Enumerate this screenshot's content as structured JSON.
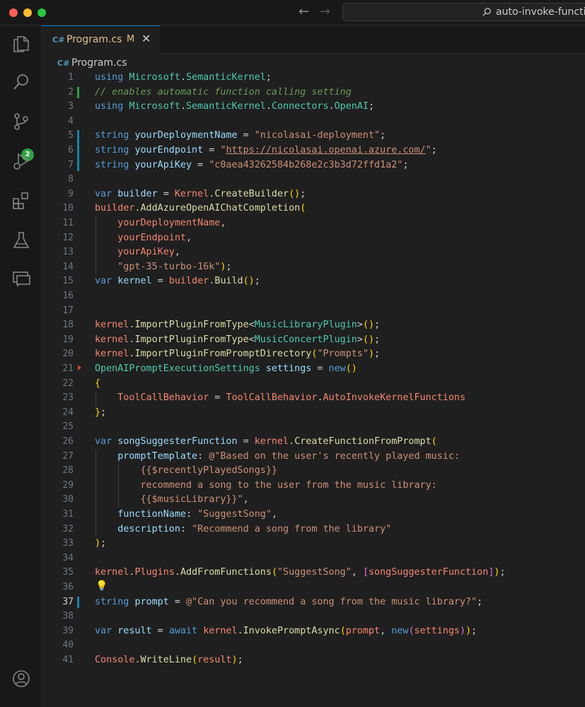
{
  "window": {
    "search_text": "auto-invoke-functio"
  },
  "tab": {
    "name": "Program.cs",
    "status": "M",
    "close": "✕"
  },
  "breadcrumb": {
    "file": "Program.cs"
  },
  "lightbulb": "💡",
  "editor": {
    "active_line": 37,
    "lines": [
      {
        "n": "1",
        "html": "<span class=\"k\">using</span> <span class=\"ns\">Microsoft</span>.<span class=\"ns\">SemanticKernel</span>;"
      },
      {
        "n": "2",
        "html": "<span class=\"cm\">// enables automatic function calling setting</span>"
      },
      {
        "n": "3",
        "html": "<span class=\"k\">using</span> <span class=\"ns\">Microsoft</span>.<span class=\"ns\">SemanticKernel</span>.<span class=\"ns\">Connectors</span>.<span class=\"ns\">OpenAI</span>;"
      },
      {
        "n": "4",
        "html": ""
      },
      {
        "n": "5",
        "html": "<span class=\"k\">string</span> <span class=\"v\">yourDeploymentName</span> = <span class=\"s\">\"nicolasai-deployment\"</span>;"
      },
      {
        "n": "6",
        "html": "<span class=\"k\">string</span> <span class=\"v\">yourEndpoint</span> = <span class=\"s\">\"<span class=\"u\">https://nicolasai.openai.azure.com/</span>\"</span>;"
      },
      {
        "n": "7",
        "html": "<span class=\"k\">string</span> <span class=\"v\">yourApiKey</span> = <span class=\"s\">\"c0aea43262584b268e2c3b3d72ffd1a2\"</span>;"
      },
      {
        "n": "8",
        "html": ""
      },
      {
        "n": "9",
        "html": "<span class=\"k\">var</span> <span class=\"v\">builder</span> = <span class=\"prop\">Kernel</span>.<span class=\"f\">CreateBuilder</span><span class=\"b1\">()</span>;"
      },
      {
        "n": "10",
        "html": "<span class=\"prop\">builder</span>.<span class=\"f\">AddAzureOpenAIChatCompletion</span><span class=\"b1\">(</span>"
      },
      {
        "n": "11",
        "html": "    <span class=\"prop\">yourDeploymentName</span>,"
      },
      {
        "n": "12",
        "html": "    <span class=\"prop\">yourEndpoint</span>,"
      },
      {
        "n": "13",
        "html": "    <span class=\"prop\">yourApiKey</span>,"
      },
      {
        "n": "14",
        "html": "    <span class=\"s\">\"gpt-35-turbo-16k\"</span><span class=\"b1\">)</span>;"
      },
      {
        "n": "15",
        "html": "<span class=\"k\">var</span> <span class=\"v\">kernel</span> = <span class=\"prop\">builder</span>.<span class=\"f\">Build</span><span class=\"b1\">()</span>;"
      },
      {
        "n": "16",
        "html": ""
      },
      {
        "n": "17",
        "html": ""
      },
      {
        "n": "18",
        "html": "<span class=\"prop\">kernel</span>.<span class=\"f\">ImportPluginFromType</span>&lt;<span class=\"cls\">MusicLibraryPlugin</span>&gt;<span class=\"b1\">()</span>;"
      },
      {
        "n": "19",
        "html": "<span class=\"prop\">kernel</span>.<span class=\"f\">ImportPluginFromType</span>&lt;<span class=\"cls\">MusicConcertPlugin</span>&gt;<span class=\"b1\">()</span>;"
      },
      {
        "n": "20",
        "html": "<span class=\"prop\">kernel</span>.<span class=\"f\">ImportPluginFromPromptDirectory</span><span class=\"b1\">(</span><span class=\"s\">\"Prompts\"</span><span class=\"b1\">)</span>;"
      },
      {
        "n": "21",
        "html": "<span class=\"cls\">OpenAIPromptExecutionSettings</span> <span class=\"v\">settings</span> = <span class=\"k\">new</span><span class=\"b1\">()</span>"
      },
      {
        "n": "22",
        "html": "<span class=\"b1\">{</span>"
      },
      {
        "n": "23",
        "html": "    <span class=\"prop\">ToolCallBehavior</span> = <span class=\"prop\">ToolCallBehavior</span>.<span class=\"prop\">AutoInvokeKernelFunctions</span>"
      },
      {
        "n": "24",
        "html": "<span class=\"b1\">}</span>;"
      },
      {
        "n": "25",
        "html": ""
      },
      {
        "n": "26",
        "html": "<span class=\"k\">var</span> <span class=\"v\">songSuggesterFunction</span> = <span class=\"prop\">kernel</span>.<span class=\"f\">CreateFunctionFromPrompt</span><span class=\"b1\">(</span>"
      },
      {
        "n": "27",
        "html": "    <span class=\"v\">promptTemplate</span>: <span class=\"s\">@\"Based on the user's recently played music:</span>"
      },
      {
        "n": "28",
        "html": "<span class=\"s\">        {{$recentlyPlayedSongs}}</span>"
      },
      {
        "n": "29",
        "html": "<span class=\"s\">        recommend a song to the user from the music library:</span>"
      },
      {
        "n": "30",
        "html": "<span class=\"s\">        {{$musicLibrary}}\"</span>,"
      },
      {
        "n": "31",
        "html": "    <span class=\"v\">functionName</span>: <span class=\"s\">\"SuggestSong\"</span>,"
      },
      {
        "n": "32",
        "html": "    <span class=\"v\">description</span>: <span class=\"s\">\"Recommend a song from the library\"</span>"
      },
      {
        "n": "33",
        "html": "<span class=\"b1\">)</span>;"
      },
      {
        "n": "34",
        "html": ""
      },
      {
        "n": "35",
        "html": "<span class=\"prop\">kernel</span>.<span class=\"prop\">Plugins</span>.<span class=\"f\">AddFromFunctions</span><span class=\"b1\">(</span><span class=\"s\">\"SuggestSong\"</span>, <span class=\"b2\">[</span><span class=\"prop\">songSuggesterFunction</span><span class=\"b2\">]</span><span class=\"b1\">)</span>;"
      },
      {
        "n": "36",
        "html": ""
      },
      {
        "n": "37",
        "html": "<span class=\"k\">string</span> <span class=\"v\">prompt</span> = <span class=\"s\">@\"Can you recommend a song from the music library?\"</span>;"
      },
      {
        "n": "38",
        "html": ""
      },
      {
        "n": "39",
        "html": "<span class=\"k\">var</span> <span class=\"v\">result</span> = <span class=\"k\">await</span> <span class=\"prop\">kernel</span>.<span class=\"f\">InvokePromptAsync</span><span class=\"b1\">(</span><span class=\"prop\">prompt</span>, <span class=\"k\">new</span><span class=\"b2\">(</span><span class=\"prop\">settings</span><span class=\"b2\">)</span><span class=\"b1\">)</span>;"
      },
      {
        "n": "40",
        "html": ""
      },
      {
        "n": "41",
        "html": "<span class=\"prop\">Console</span>.<span class=\"f\">WriteLine</span><span class=\"b1\">(</span><span class=\"prop\">result</span><span class=\"b1\">)</span>;"
      }
    ]
  },
  "activity_badge": "2",
  "icons": {
    "explorer": "files-icon",
    "search": "search-icon",
    "scm": "source-control-icon",
    "debug": "run-debug-icon",
    "extensions": "extensions-icon",
    "testing": "beaker-icon",
    "remote": "remote-explorer-icon",
    "account": "account-icon"
  }
}
